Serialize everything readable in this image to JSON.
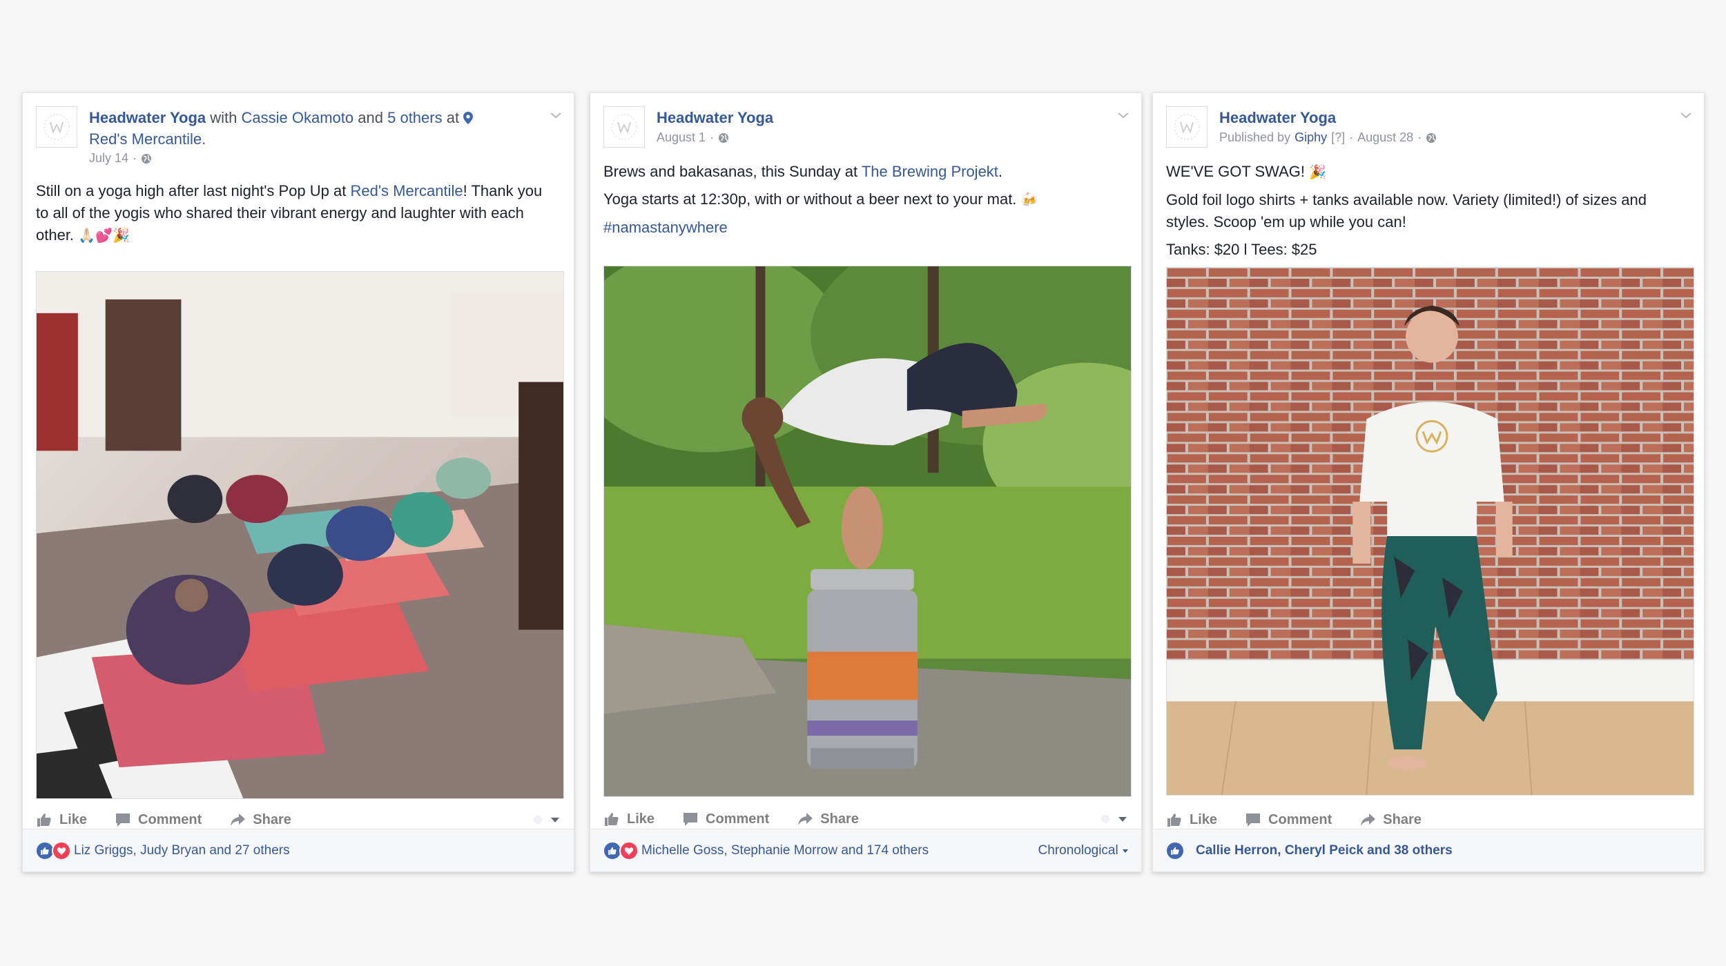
{
  "colors": {
    "link": "#365899",
    "like_blue": "#4267b2",
    "love_red": "#f33e58",
    "muted": "#90949c"
  },
  "posts": [
    {
      "page_name": "Headwater Yoga",
      "with_text": "with",
      "tagged_person": "Cassie Okamoto",
      "and_text": "and",
      "others": "5 others",
      "at_text": "at",
      "location": "Red's Mercantile.",
      "date": "July 14",
      "dot": "·",
      "text_before": "Still on a yoga high after last night's Pop Up at ",
      "text_link": "Red's Mercantile",
      "text_after": "! Thank you to all of the yogis who shared their vibrant energy and laughter with each other.",
      "emoji": "🙏🏻💕🎉",
      "actions": {
        "like": "Like",
        "comment": "Comment",
        "share": "Share"
      },
      "reactors": "Liz Griggs, Judy Bryan and 27 others"
    },
    {
      "page_name": "Headwater Yoga",
      "date": "August 1",
      "dot": "·",
      "line1_before": "Brews and bakasanas, this Sunday at ",
      "line1_link": "The Brewing Projekt",
      "line1_after": ".",
      "line2": "Yoga starts at 12:30p, with or without a beer next to your mat.",
      "line2_emoji": "🍻",
      "hashtag": "#namastanywhere",
      "actions": {
        "like": "Like",
        "comment": "Comment",
        "share": "Share"
      },
      "reactors": "Michelle Goss, Stephanie Morrow and 174 others",
      "sort": "Chronological"
    },
    {
      "page_name": "Headwater Yoga",
      "published_by": "Published by",
      "publisher": "Giphy",
      "publisher_note": "[?]",
      "dot": "·",
      "date": "August 28",
      "line1": "WE'VE GOT SWAG!",
      "line1_emoji": "🎉",
      "line2": "Gold foil logo shirts + tanks available now. Variety (limited!) of sizes and styles. Scoop 'em up while you can!",
      "line3": "Tanks: $20 l Tees: $25",
      "actions": {
        "like": "Like",
        "comment": "Comment",
        "share": "Share"
      },
      "reactors": "Callie Herron, Cheryl Peick and 38 others"
    }
  ]
}
